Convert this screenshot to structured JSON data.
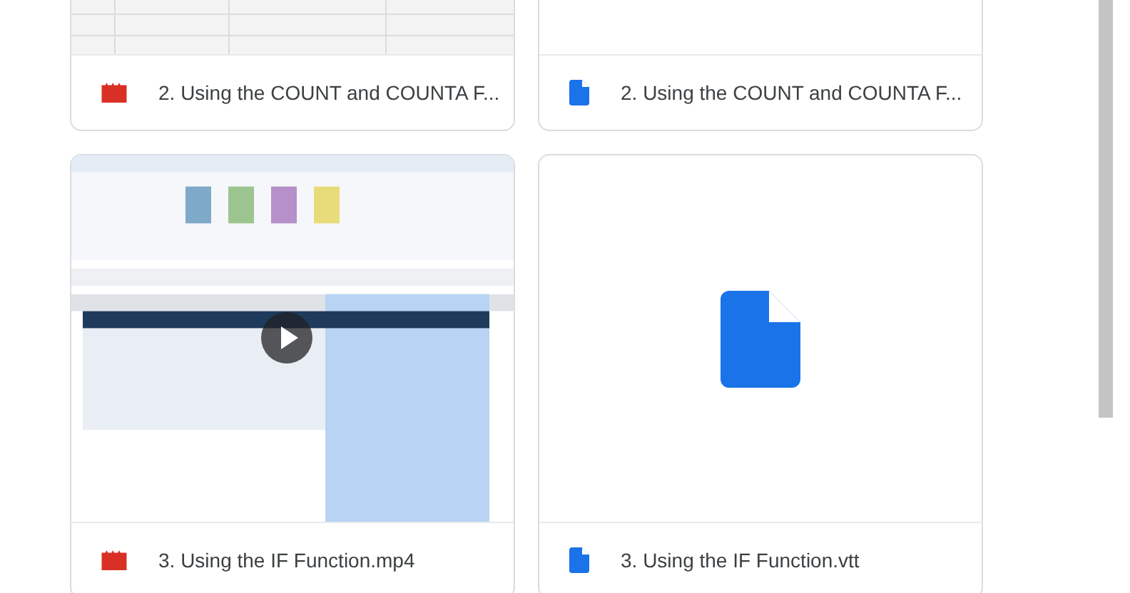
{
  "files": [
    {
      "kind": "video",
      "name": "2. Using the COUNT and COUNTA F...",
      "play_button": false
    },
    {
      "kind": "doc",
      "name": "2. Using the COUNT and COUNTA F...",
      "preview": {
        "kind": "blank"
      }
    },
    {
      "kind": "video",
      "name": "3. Using the IF Function.mp4",
      "play_button": true
    },
    {
      "kind": "doc",
      "name": "3. Using the IF Function.vtt",
      "preview": {
        "kind": "icon"
      }
    }
  ]
}
